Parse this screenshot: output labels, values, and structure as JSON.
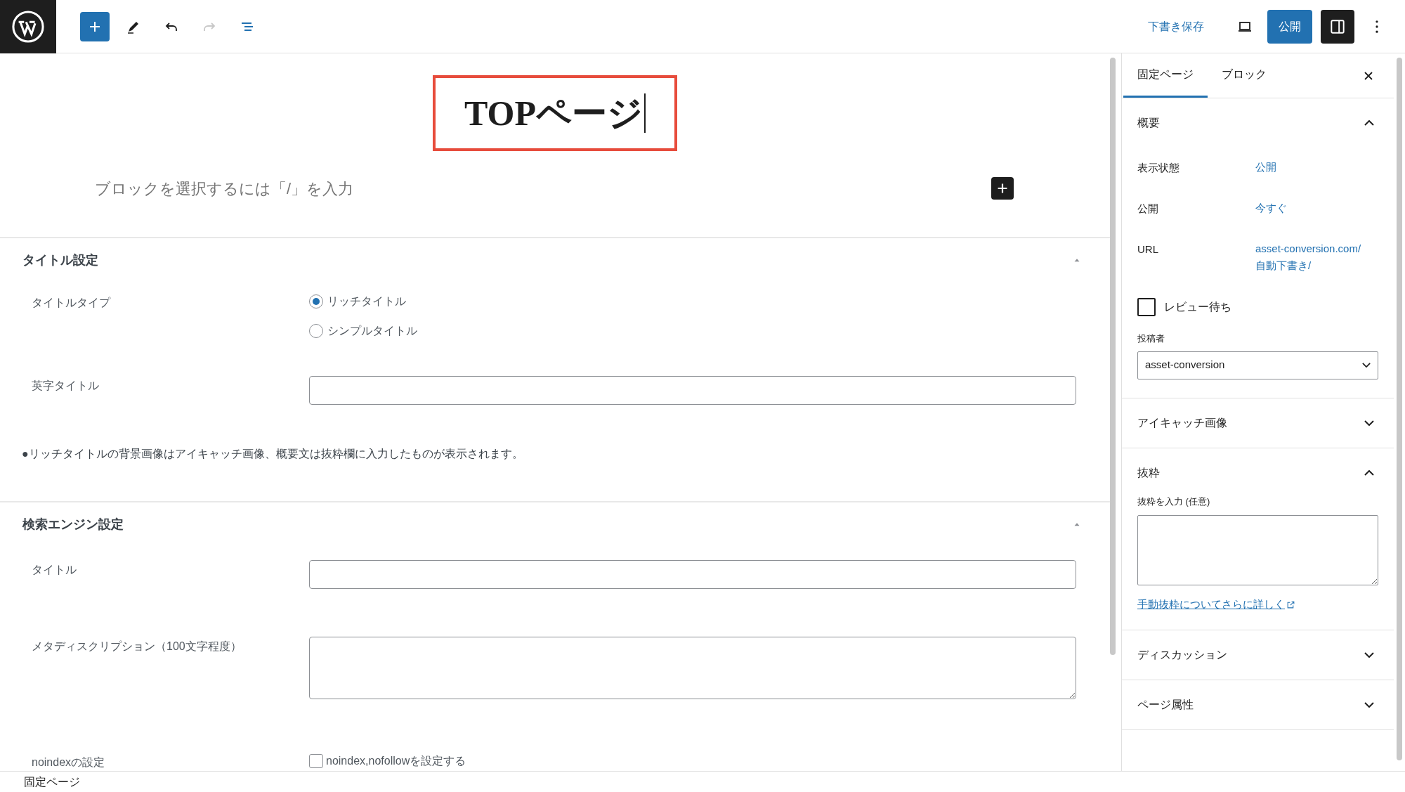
{
  "toolbar": {
    "save_draft": "下書き保存",
    "publish": "公開",
    "sidebar_toggle": {
      "pressed": true
    },
    "redo": {
      "disabled": true
    }
  },
  "editor": {
    "title": "TOPページ",
    "placeholder": "ブロックを選択するには「/」を入力"
  },
  "metaboxes": [
    {
      "title": "タイトル設定",
      "expanded": true,
      "fields": [
        {
          "kind": "radio",
          "label": "タイトルタイプ",
          "options": [
            {
              "label": "リッチタイトル",
              "selected": true
            },
            {
              "label": "シンプルタイトル",
              "selected": false
            }
          ]
        },
        {
          "kind": "text",
          "label": "英字タイトル"
        },
        {
          "kind": "note",
          "text": "●リッチタイトルの背景画像はアイキャッチ画像、概要文は抜粋欄に入力したものが表示されます。"
        }
      ]
    },
    {
      "title": "検索エンジン設定",
      "expanded": true,
      "fields": [
        {
          "kind": "text",
          "label": "タイトル"
        },
        {
          "kind": "textarea",
          "label": "メタディスクリプション（100文字程度）"
        },
        {
          "kind": "checkbox",
          "label": "noindexの設定",
          "option": "noindex,nofollowを設定する",
          "checked": false
        }
      ]
    }
  ],
  "footer": {
    "breadcrumb": "固定ページ"
  },
  "sidebar": {
    "tabs": [
      {
        "label": "固定ページ",
        "selected": true
      },
      {
        "label": "ブロック",
        "selected": false
      }
    ],
    "panels": [
      {
        "kind": "summary",
        "title": "概要",
        "expanded": true,
        "rows": [
          {
            "label": "表示状態",
            "value": "公開"
          },
          {
            "label": "公開",
            "value": "今すぐ"
          },
          {
            "label": "URL",
            "value": "asset-conversion.com/自動下書き/"
          }
        ],
        "review": {
          "label": "レビュー待ち",
          "checked": false
        },
        "author": {
          "label": "投稿者",
          "value": "asset-conversion"
        }
      },
      {
        "title": "アイキャッチ画像",
        "expanded": false
      },
      {
        "kind": "excerpt",
        "title": "抜粋",
        "expanded": true,
        "label": "抜粋を入力 (任意)",
        "link": "手動抜粋についてさらに詳しく"
      },
      {
        "title": "ディスカッション",
        "expanded": false
      },
      {
        "title": "ページ属性",
        "expanded": false
      }
    ]
  }
}
